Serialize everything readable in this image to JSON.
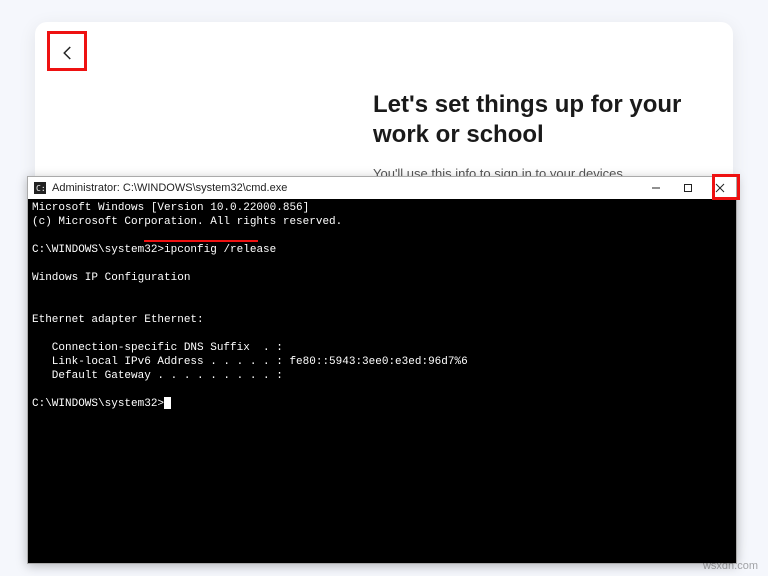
{
  "oobe": {
    "title": "Let's set things up for your work or school",
    "subtitle": "You'll use this info to sign in to your devices."
  },
  "cmd": {
    "title": "Administrator: C:\\WINDOWS\\system32\\cmd.exe",
    "lines": {
      "l1": "Microsoft Windows [Version 10.0.22000.856]",
      "l2": "(c) Microsoft Corporation. All rights reserved.",
      "l3_prompt": "C:\\WINDOWS\\system32>",
      "l3_cmd": "ipconfig /release",
      "l4": "Windows IP Configuration",
      "l5": "Ethernet adapter Ethernet:",
      "l6": "   Connection-specific DNS Suffix  . :",
      "l7": "   Link-local IPv6 Address . . . . . : fe80::5943:3ee0:e3ed:96d7%6",
      "l8": "   Default Gateway . . . . . . . . . :",
      "l9": "C:\\WINDOWS\\system32>"
    }
  },
  "watermark": "wsxdn.com"
}
